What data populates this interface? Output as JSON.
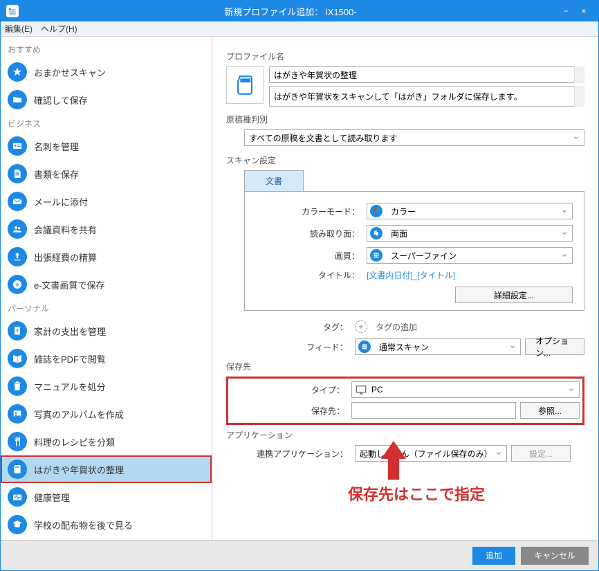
{
  "window": {
    "title": "新規プロファイル追加： iX1500-",
    "minimize": "−",
    "close": "×"
  },
  "menu": {
    "edit": "編集(E)",
    "help": "ヘルプ(H)"
  },
  "sidebar": {
    "cat1": "おすすめ",
    "cat2": "ビジネス",
    "cat3": "パーソナル",
    "items": [
      {
        "label": "おまかせスキャン"
      },
      {
        "label": "確認して保存"
      },
      {
        "label": "名刺を管理"
      },
      {
        "label": "書類を保存"
      },
      {
        "label": "メールに添付"
      },
      {
        "label": "会議資料を共有"
      },
      {
        "label": "出張経費の精算"
      },
      {
        "label": "e-文書画質で保存"
      },
      {
        "label": "家計の支出を管理"
      },
      {
        "label": "雑誌をPDFで閲覧"
      },
      {
        "label": "マニュアルを処分"
      },
      {
        "label": "写真のアルバムを作成"
      },
      {
        "label": "料理のレシピを分類"
      },
      {
        "label": "はがきや年賀状の整理"
      },
      {
        "label": "健康管理"
      },
      {
        "label": "学校の配布物を後で見る"
      }
    ]
  },
  "main": {
    "profile_name_label": "プロファイル名",
    "profile_name_value": "はがきや年賀状の整理",
    "profile_desc_value": "はがきや年賀状をスキャンして「はがき」フォルダに保存します。",
    "doctype_label": "原稿種判別",
    "doctype_value": "すべての原稿を文書として読み取ります",
    "scan_settings_label": "スキャン設定",
    "tab_document": "文書",
    "color_mode_label": "カラーモード：",
    "color_mode_value": "カラー",
    "side_label": "読み取り面：",
    "side_value": "両面",
    "quality_label": "画質：",
    "quality_value": "スーパーファイン",
    "title_label": "タイトル：",
    "title_value": "[文書内日付]_[タイトル]",
    "detail_btn": "詳細設定...",
    "tag_label": "タグ：",
    "tag_value": "タグの追加",
    "feed_label": "フィード：",
    "feed_value": "通常スキャン",
    "option_btn": "オプション...",
    "save_section": "保存先",
    "save_type_label": "タイプ：",
    "save_type_value": "PC",
    "save_path_label": "保存先：",
    "save_path_value": "",
    "browse_btn": "参照...",
    "app_section": "アプリケーション",
    "app_label": "連携アプリケーション：",
    "app_value": "起動しません（ファイル保存のみ）",
    "settings_btn": "設定...",
    "annotation": "保存先はここで指定"
  },
  "footer": {
    "add": "追加",
    "cancel": "キャンセル"
  }
}
